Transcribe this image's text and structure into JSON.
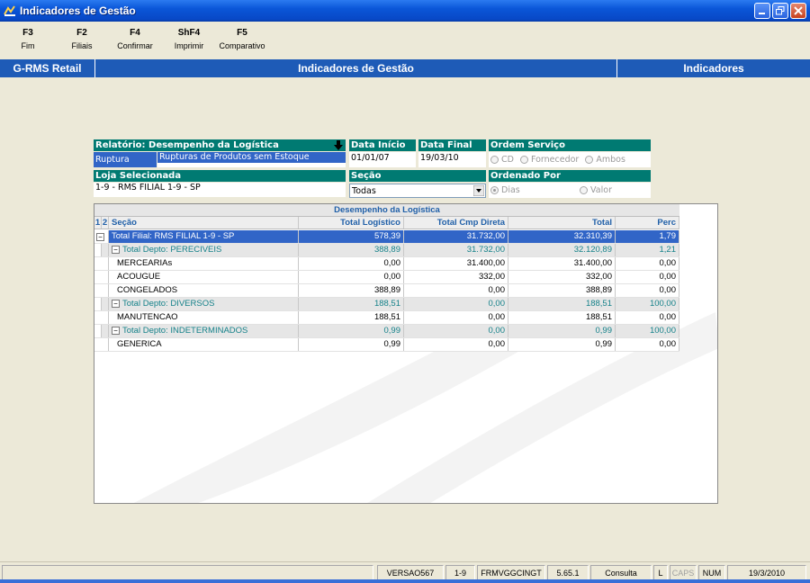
{
  "window": {
    "title": "Indicadores de Gestão"
  },
  "function_keys": [
    {
      "key": "F3",
      "label": "Fim"
    },
    {
      "key": "F2",
      "label": "Filiais"
    },
    {
      "key": "F4",
      "label": "Confirmar"
    },
    {
      "key": "ShF4",
      "label": "Imprimir"
    },
    {
      "key": "F5",
      "label": "Comparativo"
    }
  ],
  "header": {
    "left": "G-RMS Retail",
    "center": "Indicadores de Gestão",
    "right": "Indicadores"
  },
  "form": {
    "relatorio_label": "Relatório: Desempenho da Logística",
    "relatorio_type": "Ruptura",
    "relatorio_value": "Rupturas de Produtos sem Estoque",
    "data_inicio_label": "Data Início",
    "data_inicio_value": "01/01/07",
    "data_final_label": "Data Final",
    "data_final_value": "19/03/10",
    "ordem_servico_label": "Ordem Serviço",
    "ordem_servico_options": [
      "CD",
      "Fornecedor",
      "Ambos"
    ],
    "loja_label": "Loja Selecionada",
    "loja_value": "1-9 - RMS FILIAL 1-9 - SP",
    "secao_label": "Seção",
    "secao_value": "Todas",
    "ordenado_label": "Ordenado Por",
    "ordenado_options": [
      "Dias",
      "Valor"
    ]
  },
  "grid": {
    "title": "Desempenho da Logística",
    "level_1": "1",
    "level_2": "2",
    "columns": [
      "Seção",
      "Total Logístico",
      "Total Cmp Direta",
      "Total",
      "Perc"
    ],
    "rows": [
      {
        "kind": "filial",
        "label": "Total Filial: RMS FILIAL 1-9 - SP",
        "v": [
          "578,39",
          "31.732,00",
          "32.310,39",
          "1,79"
        ]
      },
      {
        "kind": "depto",
        "label": "Total Depto: PERECIVEIS",
        "v": [
          "388,89",
          "31.732,00",
          "32.120,89",
          "1,21"
        ]
      },
      {
        "kind": "item",
        "label": "MERCEARIAs",
        "v": [
          "0,00",
          "31.400,00",
          "31.400,00",
          "0,00"
        ]
      },
      {
        "kind": "item",
        "label": "ACOUGUE",
        "v": [
          "0,00",
          "332,00",
          "332,00",
          "0,00"
        ]
      },
      {
        "kind": "item",
        "label": "CONGELADOS",
        "v": [
          "388,89",
          "0,00",
          "388,89",
          "0,00"
        ]
      },
      {
        "kind": "depto",
        "label": "Total Depto: DIVERSOS",
        "v": [
          "188,51",
          "0,00",
          "188,51",
          "100,00"
        ]
      },
      {
        "kind": "item",
        "label": "MANUTENCAO",
        "v": [
          "188,51",
          "0,00",
          "188,51",
          "0,00"
        ]
      },
      {
        "kind": "depto",
        "label": "Total Depto: INDETERMINADOS",
        "v": [
          "0,99",
          "0,00",
          "0,99",
          "100,00"
        ]
      },
      {
        "kind": "item",
        "label": "GENERICA",
        "v": [
          "0,99",
          "0,00",
          "0,99",
          "0,00"
        ]
      }
    ]
  },
  "status": {
    "version": "VERSAO567",
    "filial": "1-9",
    "form": "FRMVGGCINGT",
    "build": "5.65.1",
    "mode": "Consulta",
    "l": "L",
    "caps": "CAPS",
    "num": "NUM",
    "date": "19/3/2010"
  }
}
